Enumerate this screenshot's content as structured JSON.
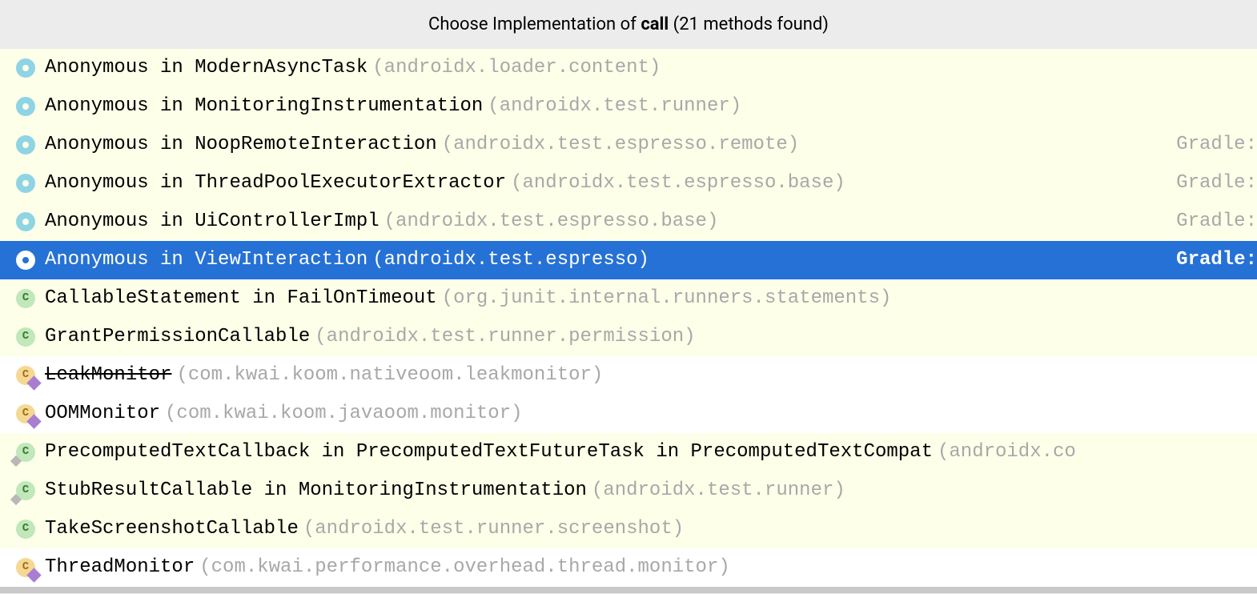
{
  "header": {
    "prefix": "Choose Implementation of ",
    "method": "call",
    "suffix": " (21 methods found)"
  },
  "rows": [
    {
      "iconType": "ring",
      "highlight": true,
      "selected": false,
      "strike": false,
      "label": "Anonymous in ModernAsyncTask",
      "package": "(androidx.loader.content)",
      "source": ""
    },
    {
      "iconType": "ring",
      "highlight": true,
      "selected": false,
      "strike": false,
      "label": "Anonymous in MonitoringInstrumentation",
      "package": "(androidx.test.runner)",
      "source": ""
    },
    {
      "iconType": "ring",
      "highlight": true,
      "selected": false,
      "strike": false,
      "label": "Anonymous in NoopRemoteInteraction",
      "package": "(androidx.test.espresso.remote)",
      "source": "Gradle:"
    },
    {
      "iconType": "ring",
      "highlight": true,
      "selected": false,
      "strike": false,
      "label": "Anonymous in ThreadPoolExecutorExtractor",
      "package": "(androidx.test.espresso.base)",
      "source": "Gradle:"
    },
    {
      "iconType": "ring",
      "highlight": true,
      "selected": false,
      "strike": false,
      "label": "Anonymous in UiControllerImpl",
      "package": "(androidx.test.espresso.base)",
      "source": "Gradle:"
    },
    {
      "iconType": "ring",
      "highlight": false,
      "selected": true,
      "strike": false,
      "label": "Anonymous in ViewInteraction",
      "package": "(androidx.test.espresso)",
      "source": "Gradle:"
    },
    {
      "iconType": "c",
      "highlight": true,
      "selected": false,
      "strike": false,
      "label": "CallableStatement in FailOnTimeout",
      "package": "(org.junit.internal.runners.statements)",
      "source": ""
    },
    {
      "iconType": "c",
      "highlight": true,
      "selected": false,
      "strike": false,
      "label": "GrantPermissionCallable",
      "package": "(androidx.test.runner.permission)",
      "source": ""
    },
    {
      "iconType": "c-orange-k",
      "highlight": false,
      "selected": false,
      "strike": true,
      "label": "LeakMonitor",
      "package": "(com.kwai.koom.nativeoom.leakmonitor)",
      "source": ""
    },
    {
      "iconType": "c-orange-k",
      "highlight": false,
      "selected": false,
      "strike": false,
      "label": "OOMMonitor",
      "package": "(com.kwai.koom.javaoom.monitor)",
      "source": ""
    },
    {
      "iconType": "c-diamond",
      "highlight": true,
      "selected": false,
      "strike": false,
      "label": "PrecomputedTextCallback in PrecomputedTextFutureTask in PrecomputedTextCompat",
      "package": "(androidx.co",
      "source": ""
    },
    {
      "iconType": "c-diamond",
      "highlight": true,
      "selected": false,
      "strike": false,
      "label": "StubResultCallable in MonitoringInstrumentation",
      "package": "(androidx.test.runner)",
      "source": ""
    },
    {
      "iconType": "c",
      "highlight": true,
      "selected": false,
      "strike": false,
      "label": "TakeScreenshotCallable",
      "package": "(androidx.test.runner.screenshot)",
      "source": ""
    },
    {
      "iconType": "c-orange-k",
      "highlight": false,
      "selected": false,
      "strike": false,
      "label": "ThreadMonitor",
      "package": "(com.kwai.performance.overhead.thread.monitor)",
      "source": ""
    }
  ]
}
